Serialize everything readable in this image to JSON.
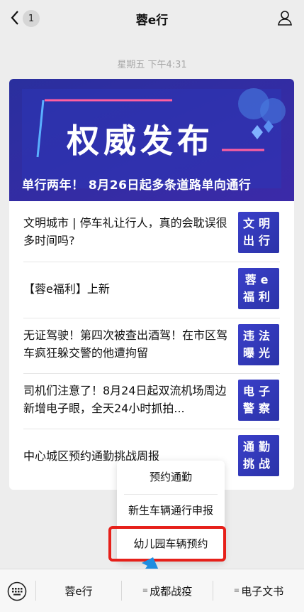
{
  "header": {
    "title": "蓉e行",
    "badge_count": "1"
  },
  "timestamp": "星期五 下午4:31",
  "banner": {
    "headline": "权威发布",
    "caption": "单行两年！ 8月26日起多条道路单向通行"
  },
  "articles": [
    {
      "title": "文明城市 | 停车礼让行人，真的会耽误很多时间吗?",
      "thumb_line1": "文明",
      "thumb_line2": "出行"
    },
    {
      "title": "【蓉e福利】上新",
      "thumb_line1": "蓉e",
      "thumb_line2": "福利"
    },
    {
      "title": "无证驾驶！第四次被查出酒驾！在市区驾车疯狂躲交警的他遭拘留",
      "thumb_line1": "违法",
      "thumb_line2": "曝光"
    },
    {
      "title": "司机们注意了！8月24日起双流机场周边新增电子眼，全天24小时抓拍...",
      "thumb_line1": "电子",
      "thumb_line2": "警察"
    },
    {
      "title": "中心城区预约通勤挑战周报",
      "thumb_line1": "通勤",
      "thumb_line2": "挑战"
    }
  ],
  "popup_menu": {
    "items": [
      "预约通勤",
      "新生车辆通行申报",
      "幼儿园车辆预约"
    ]
  },
  "bottom_menu": {
    "items": [
      "蓉e行",
      "成都战疫",
      "电子文书"
    ]
  },
  "colors": {
    "highlight": "#e6201a",
    "banner_bg": "#2a2f9e",
    "arrow": "#1e8de0"
  }
}
